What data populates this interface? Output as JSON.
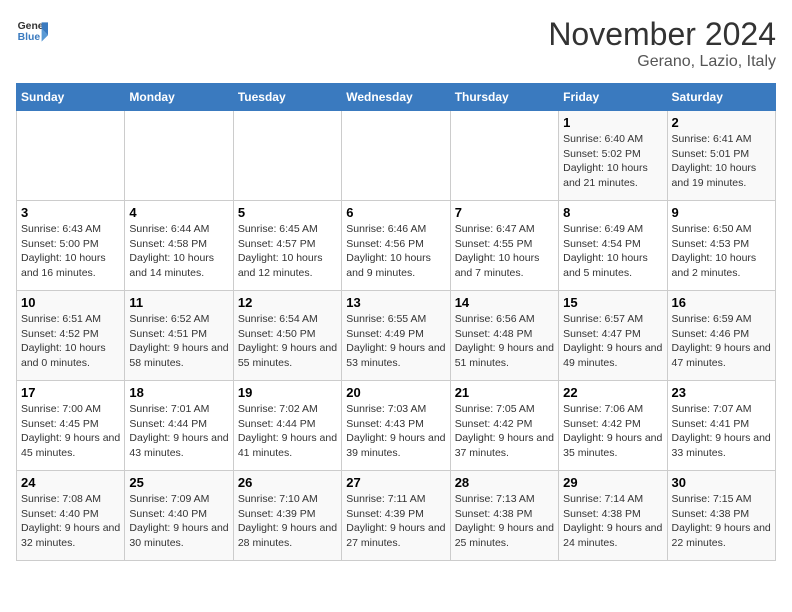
{
  "header": {
    "logo_line1": "General",
    "logo_line2": "Blue",
    "month": "November 2024",
    "location": "Gerano, Lazio, Italy"
  },
  "days_of_week": [
    "Sunday",
    "Monday",
    "Tuesday",
    "Wednesday",
    "Thursday",
    "Friday",
    "Saturday"
  ],
  "weeks": [
    [
      {
        "day": "",
        "info": ""
      },
      {
        "day": "",
        "info": ""
      },
      {
        "day": "",
        "info": ""
      },
      {
        "day": "",
        "info": ""
      },
      {
        "day": "",
        "info": ""
      },
      {
        "day": "1",
        "info": "Sunrise: 6:40 AM\nSunset: 5:02 PM\nDaylight: 10 hours and 21 minutes."
      },
      {
        "day": "2",
        "info": "Sunrise: 6:41 AM\nSunset: 5:01 PM\nDaylight: 10 hours and 19 minutes."
      }
    ],
    [
      {
        "day": "3",
        "info": "Sunrise: 6:43 AM\nSunset: 5:00 PM\nDaylight: 10 hours and 16 minutes."
      },
      {
        "day": "4",
        "info": "Sunrise: 6:44 AM\nSunset: 4:58 PM\nDaylight: 10 hours and 14 minutes."
      },
      {
        "day": "5",
        "info": "Sunrise: 6:45 AM\nSunset: 4:57 PM\nDaylight: 10 hours and 12 minutes."
      },
      {
        "day": "6",
        "info": "Sunrise: 6:46 AM\nSunset: 4:56 PM\nDaylight: 10 hours and 9 minutes."
      },
      {
        "day": "7",
        "info": "Sunrise: 6:47 AM\nSunset: 4:55 PM\nDaylight: 10 hours and 7 minutes."
      },
      {
        "day": "8",
        "info": "Sunrise: 6:49 AM\nSunset: 4:54 PM\nDaylight: 10 hours and 5 minutes."
      },
      {
        "day": "9",
        "info": "Sunrise: 6:50 AM\nSunset: 4:53 PM\nDaylight: 10 hours and 2 minutes."
      }
    ],
    [
      {
        "day": "10",
        "info": "Sunrise: 6:51 AM\nSunset: 4:52 PM\nDaylight: 10 hours and 0 minutes."
      },
      {
        "day": "11",
        "info": "Sunrise: 6:52 AM\nSunset: 4:51 PM\nDaylight: 9 hours and 58 minutes."
      },
      {
        "day": "12",
        "info": "Sunrise: 6:54 AM\nSunset: 4:50 PM\nDaylight: 9 hours and 55 minutes."
      },
      {
        "day": "13",
        "info": "Sunrise: 6:55 AM\nSunset: 4:49 PM\nDaylight: 9 hours and 53 minutes."
      },
      {
        "day": "14",
        "info": "Sunrise: 6:56 AM\nSunset: 4:48 PM\nDaylight: 9 hours and 51 minutes."
      },
      {
        "day": "15",
        "info": "Sunrise: 6:57 AM\nSunset: 4:47 PM\nDaylight: 9 hours and 49 minutes."
      },
      {
        "day": "16",
        "info": "Sunrise: 6:59 AM\nSunset: 4:46 PM\nDaylight: 9 hours and 47 minutes."
      }
    ],
    [
      {
        "day": "17",
        "info": "Sunrise: 7:00 AM\nSunset: 4:45 PM\nDaylight: 9 hours and 45 minutes."
      },
      {
        "day": "18",
        "info": "Sunrise: 7:01 AM\nSunset: 4:44 PM\nDaylight: 9 hours and 43 minutes."
      },
      {
        "day": "19",
        "info": "Sunrise: 7:02 AM\nSunset: 4:44 PM\nDaylight: 9 hours and 41 minutes."
      },
      {
        "day": "20",
        "info": "Sunrise: 7:03 AM\nSunset: 4:43 PM\nDaylight: 9 hours and 39 minutes."
      },
      {
        "day": "21",
        "info": "Sunrise: 7:05 AM\nSunset: 4:42 PM\nDaylight: 9 hours and 37 minutes."
      },
      {
        "day": "22",
        "info": "Sunrise: 7:06 AM\nSunset: 4:42 PM\nDaylight: 9 hours and 35 minutes."
      },
      {
        "day": "23",
        "info": "Sunrise: 7:07 AM\nSunset: 4:41 PM\nDaylight: 9 hours and 33 minutes."
      }
    ],
    [
      {
        "day": "24",
        "info": "Sunrise: 7:08 AM\nSunset: 4:40 PM\nDaylight: 9 hours and 32 minutes."
      },
      {
        "day": "25",
        "info": "Sunrise: 7:09 AM\nSunset: 4:40 PM\nDaylight: 9 hours and 30 minutes."
      },
      {
        "day": "26",
        "info": "Sunrise: 7:10 AM\nSunset: 4:39 PM\nDaylight: 9 hours and 28 minutes."
      },
      {
        "day": "27",
        "info": "Sunrise: 7:11 AM\nSunset: 4:39 PM\nDaylight: 9 hours and 27 minutes."
      },
      {
        "day": "28",
        "info": "Sunrise: 7:13 AM\nSunset: 4:38 PM\nDaylight: 9 hours and 25 minutes."
      },
      {
        "day": "29",
        "info": "Sunrise: 7:14 AM\nSunset: 4:38 PM\nDaylight: 9 hours and 24 minutes."
      },
      {
        "day": "30",
        "info": "Sunrise: 7:15 AM\nSunset: 4:38 PM\nDaylight: 9 hours and 22 minutes."
      }
    ]
  ]
}
